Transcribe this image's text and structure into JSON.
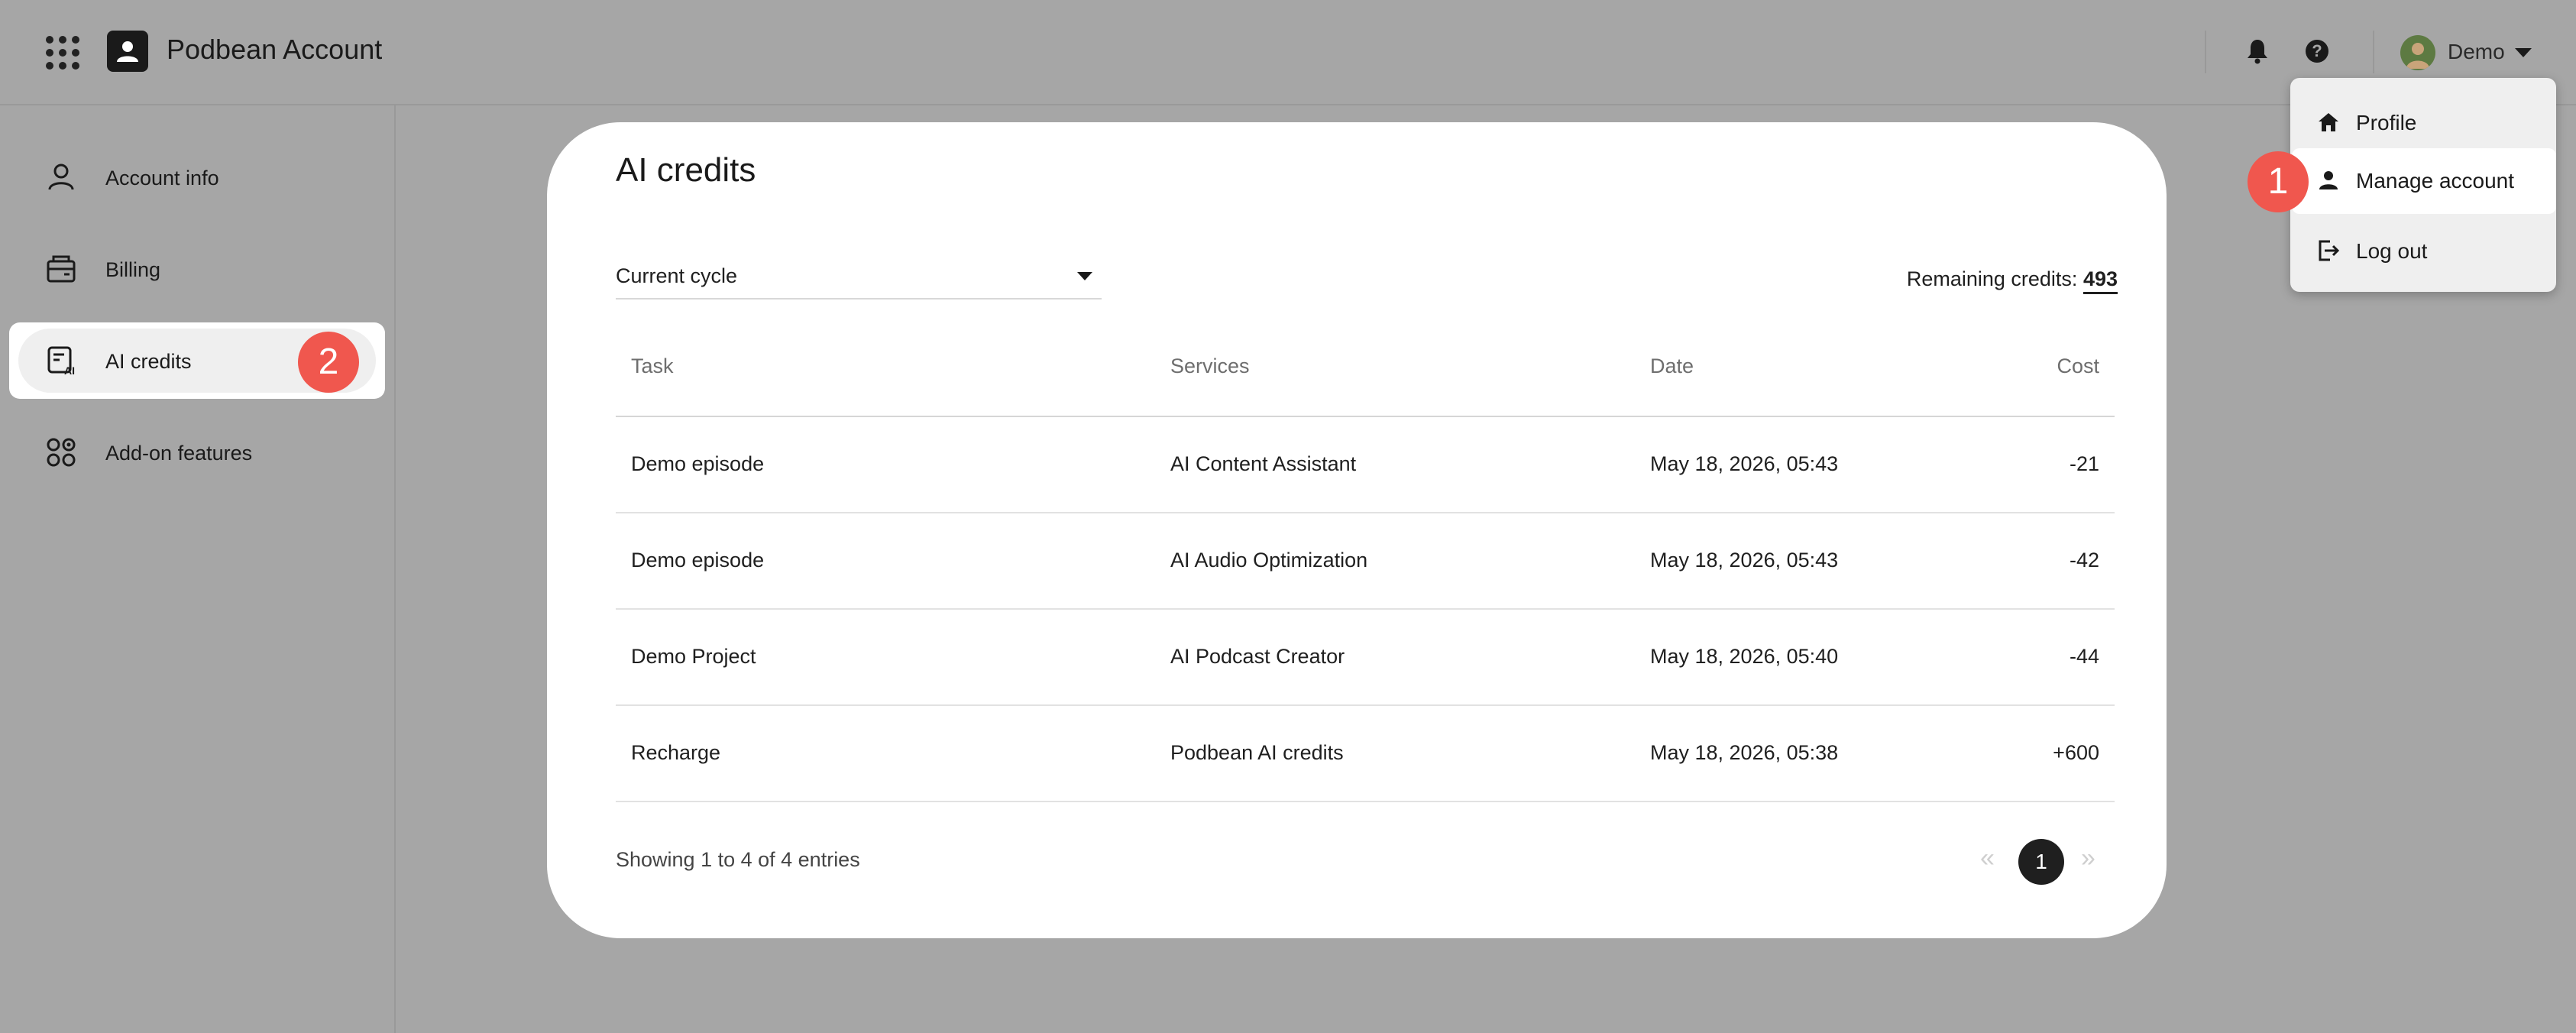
{
  "header": {
    "title": "Podbean Account",
    "user_name": "Demo"
  },
  "sidebar": {
    "items": [
      {
        "label": "Account info",
        "icon": "person-icon"
      },
      {
        "label": "Billing",
        "icon": "wallet-icon"
      },
      {
        "label": "AI credits",
        "icon": "ai-credits-icon"
      },
      {
        "label": "Add-on features",
        "icon": "addon-icon"
      }
    ]
  },
  "main": {
    "title": "AI credits",
    "cycle_select": "Current cycle",
    "remaining_label": "Remaining credits:",
    "remaining_value": "493",
    "columns": [
      "Task",
      "Services",
      "Date",
      "Cost"
    ],
    "rows": [
      {
        "task": "Demo episode",
        "service": "AI Content Assistant",
        "date": "May 18, 2026, 05:43",
        "cost": "-21"
      },
      {
        "task": "Demo episode",
        "service": "AI Audio Optimization",
        "date": "May 18, 2026, 05:43",
        "cost": "-42"
      },
      {
        "task": "Demo Project",
        "service": "AI Podcast Creator",
        "date": "May 18, 2026, 05:40",
        "cost": "-44"
      },
      {
        "task": "Recharge",
        "service": "Podbean AI credits",
        "date": "May 18, 2026, 05:38",
        "cost": "+600"
      }
    ],
    "showing": "Showing 1 to 4 of 4 entries",
    "pagination": {
      "prev": "«",
      "current": "1",
      "next": "»"
    }
  },
  "user_menu": {
    "items": [
      {
        "label": "Profile",
        "icon": "home-icon"
      },
      {
        "label": "Manage account",
        "icon": "person-icon"
      },
      {
        "label": "Log out",
        "icon": "logout-icon"
      }
    ]
  },
  "annotations": {
    "badge_1": "1",
    "badge_2": "2"
  },
  "colors": {
    "overlay": "#a6a6a6",
    "badge": "#f0574e",
    "avatar": "#5d7a42"
  }
}
